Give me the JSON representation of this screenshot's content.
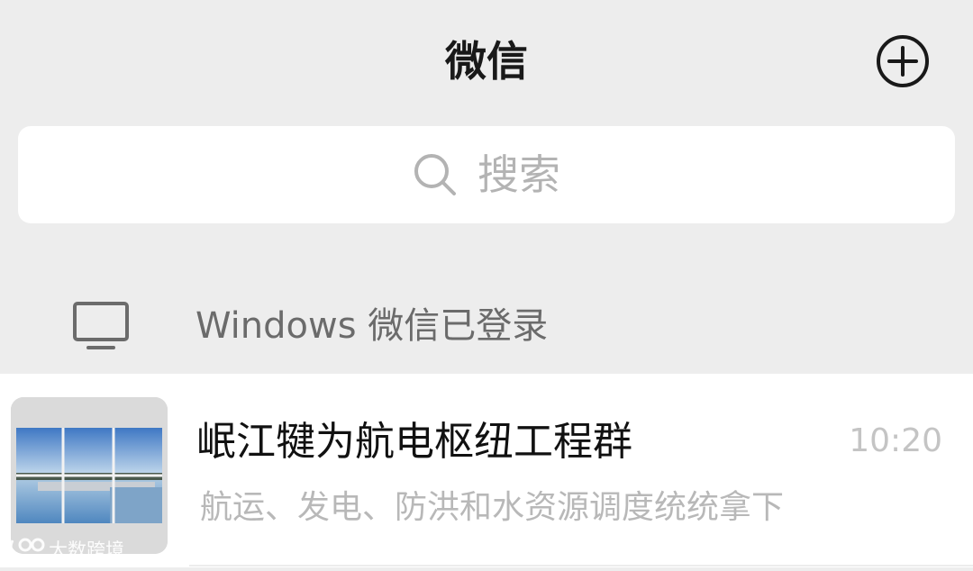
{
  "header": {
    "title": "微信",
    "add_icon": "plus-circle-icon"
  },
  "search": {
    "icon": "search-icon",
    "placeholder": "搜索"
  },
  "login_notice": {
    "icon": "monitor-icon",
    "text": "Windows 微信已登录"
  },
  "chats": [
    {
      "name": "岷江犍为航电枢纽工程群",
      "time": "10:20",
      "preview": "航运、发电、防洪和水资源调度统统拿下",
      "avatar": "group-photo-avatar"
    }
  ],
  "watermark": {
    "text": "大数跨境"
  },
  "colors": {
    "background": "#ededed",
    "surface": "#ffffff",
    "title": "#191919",
    "muted": "#b8b8b8"
  }
}
